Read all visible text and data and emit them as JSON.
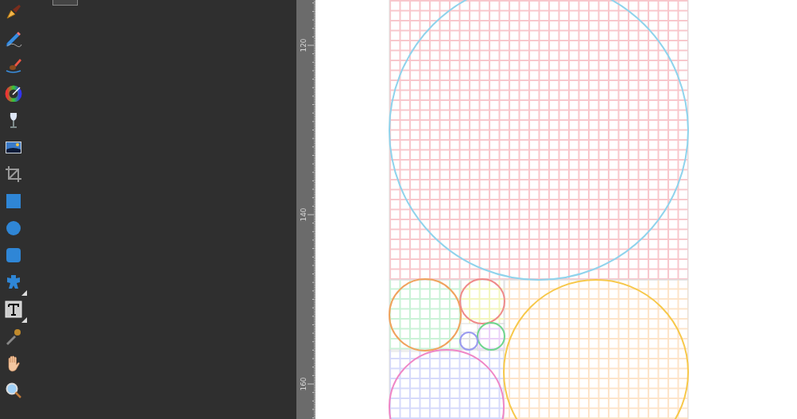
{
  "tools": [
    {
      "kind": "pen",
      "flyout": false
    },
    {
      "kind": "pencil",
      "flyout": false
    },
    {
      "kind": "brush",
      "flyout": false
    },
    {
      "kind": "color-wheel",
      "flyout": false
    },
    {
      "kind": "glass",
      "flyout": false
    },
    {
      "kind": "image",
      "flyout": false
    },
    {
      "kind": "crop",
      "flyout": false
    },
    {
      "kind": "square",
      "flyout": false
    },
    {
      "kind": "circle",
      "flyout": false
    },
    {
      "kind": "rounded-square",
      "flyout": false
    },
    {
      "kind": "star",
      "flyout": true
    },
    {
      "kind": "text",
      "flyout": true
    },
    {
      "kind": "eyedropper",
      "flyout": false
    },
    {
      "kind": "hand",
      "flyout": false
    },
    {
      "kind": "zoom",
      "flyout": false
    }
  ],
  "ruler": {
    "labels": [
      "120",
      "140",
      "160"
    ]
  }
}
